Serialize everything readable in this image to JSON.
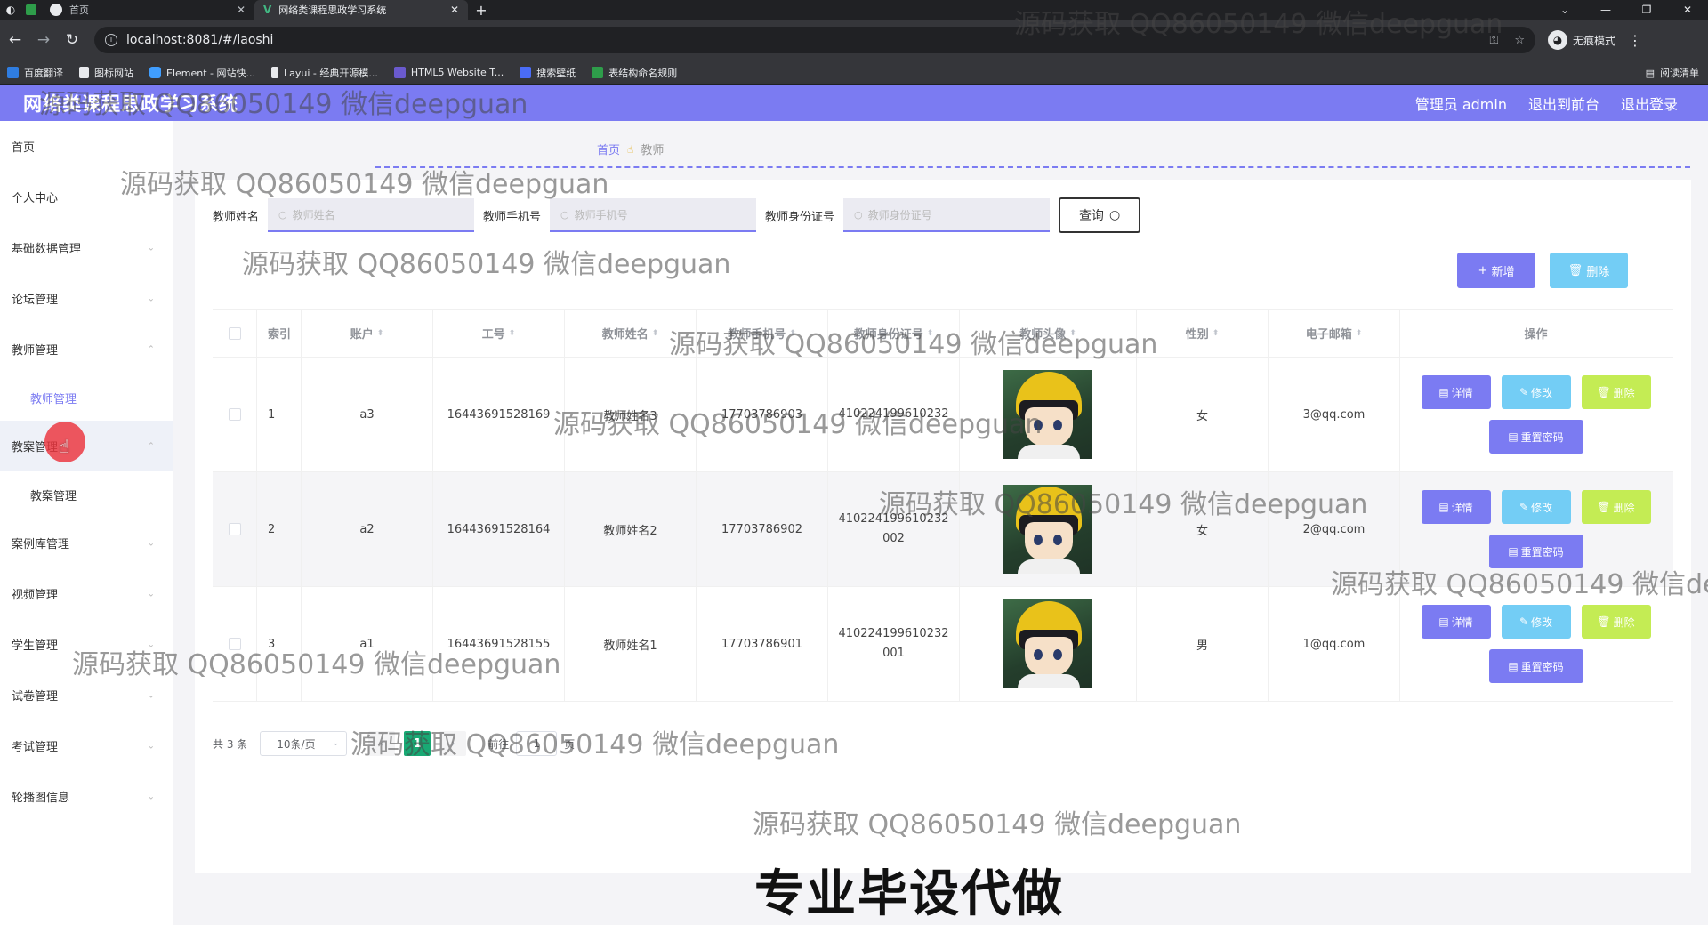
{
  "browser": {
    "tabs": [
      {
        "title": "首页"
      },
      {
        "title": "网络类课程思政学习系统"
      }
    ],
    "url": "localhost:8081/#/laoshi",
    "incognito_label": "无痕模式",
    "bookmarks": [
      "百度翻译",
      "图标网站",
      "Element - 网站快...",
      "Layui - 经典开源模...",
      "HTML5 Website T...",
      "搜索壁纸",
      "表结构命名规则"
    ],
    "reading_list": "阅读清单",
    "colors": {
      "chrome_bg": "#35363a",
      "tabbar_bg": "#202124"
    }
  },
  "header": {
    "title": "网络类课程思政学习系统",
    "admin_label": "管理员 admin",
    "front_link": "退出到前台",
    "logout_link": "退出登录",
    "color": "#7b7bf2"
  },
  "sidebar": {
    "items": [
      {
        "label": "首页"
      },
      {
        "label": "个人中心"
      },
      {
        "label": "基础数据管理"
      },
      {
        "label": "论坛管理"
      },
      {
        "label": "教师管理",
        "sub": "教师管理"
      },
      {
        "label": "教案管理",
        "sub": "教案管理"
      },
      {
        "label": "案例库管理"
      },
      {
        "label": "视频管理"
      },
      {
        "label": "学生管理"
      },
      {
        "label": "试卷管理"
      },
      {
        "label": "考试管理"
      },
      {
        "label": "轮播图信息"
      }
    ]
  },
  "breadcrumb": {
    "home": "首页",
    "current": "教师"
  },
  "search": {
    "name_label": "教师姓名",
    "name_placeholder": "教师姓名",
    "phone_label": "教师手机号",
    "phone_placeholder": "教师手机号",
    "id_label": "教师身份证号",
    "id_placeholder": "教师身份证号",
    "query_button": "查询"
  },
  "actions": {
    "add": "新增",
    "delete": "删除"
  },
  "table": {
    "headers": [
      "索引",
      "账户",
      "工号",
      "教师姓名",
      "教师手机号",
      "教师身份证号",
      "教师头像",
      "性别",
      "电子邮箱",
      "操作"
    ],
    "rows": [
      {
        "index": "1",
        "account": "a3",
        "job_no": "16443691528169",
        "name": "教师姓名3",
        "phone": "17703786903",
        "id_card": "410224199610232",
        "sex": "女",
        "email": "3@qq.com"
      },
      {
        "index": "2",
        "account": "a2",
        "job_no": "16443691528164",
        "name": "教师姓名2",
        "phone": "17703786902",
        "id_card": "410224199610232 002",
        "sex": "女",
        "email": "2@qq.com"
      },
      {
        "index": "3",
        "account": "a1",
        "job_no": "16443691528155",
        "name": "教师姓名1",
        "phone": "17703786901",
        "id_card": "410224199610232 001",
        "sex": "男",
        "email": "1@qq.com"
      }
    ],
    "ops": {
      "detail": "详情",
      "edit": "修改",
      "remove": "删除",
      "reset": "重置密码"
    }
  },
  "pager": {
    "total": "共 3 条",
    "page_size": "10条/页",
    "current": "1",
    "goto_prefix": "前往",
    "goto_value": "1",
    "goto_suffix": "页"
  },
  "watermark": {
    "text": "源码获取 QQ86050149 微信deepguan",
    "clipped": "源码获取 QQ86050149 微信de"
  },
  "promo": "专业毕设代做"
}
